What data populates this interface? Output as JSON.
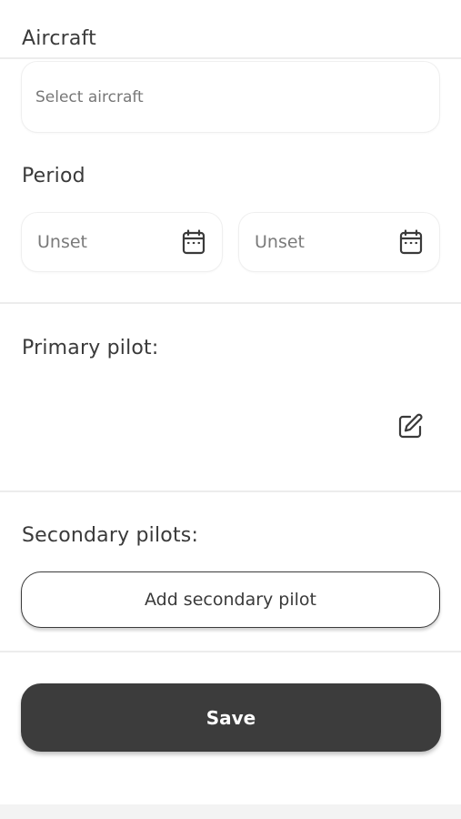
{
  "aircraft": {
    "label": "Aircraft",
    "placeholder": "Select aircraft"
  },
  "period": {
    "label": "Period",
    "start": "Unset",
    "end": "Unset"
  },
  "primary_pilot": {
    "label": "Primary pilot:"
  },
  "secondary_pilots": {
    "label": "Secondary pilots:",
    "add_button": "Add secondary pilot"
  },
  "save_button": "Save",
  "colors": {
    "save_bg": "#3c3c3c",
    "divider": "#ececec"
  }
}
